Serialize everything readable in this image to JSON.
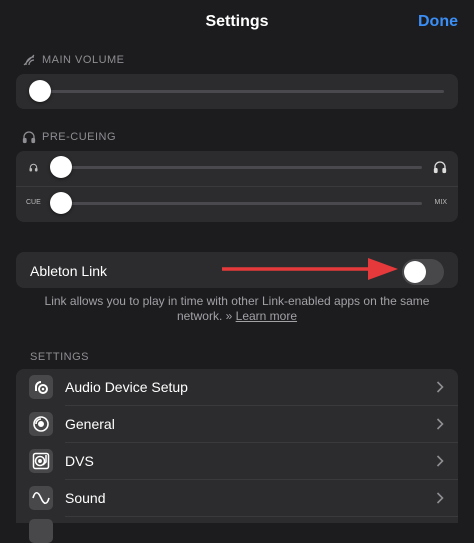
{
  "header": {
    "title": "Settings",
    "done_label": "Done"
  },
  "main_volume": {
    "label": "MAIN VOLUME",
    "value": 0
  },
  "precueing": {
    "label": "PRE-CUEING",
    "headphone_volume": 0,
    "cue_mix_value": 0,
    "cue_label": "CUE",
    "mix_label": "MIX"
  },
  "ableton_link": {
    "label": "Ableton Link",
    "enabled": false,
    "description": "Link allows you to play in time with other Link-enabled apps on the same network. »",
    "learn_more": "Learn more"
  },
  "settings_section": {
    "label": "SETTINGS",
    "items": [
      {
        "label": "Audio Device Setup",
        "icon": "speaker-icon"
      },
      {
        "label": "General",
        "icon": "record-icon"
      },
      {
        "label": "DVS",
        "icon": "turntable-icon"
      },
      {
        "label": "Sound",
        "icon": "wave-icon"
      }
    ]
  },
  "colors": {
    "accent": "#3a8ef6",
    "background": "#1c1c1e",
    "card": "#2c2c2e",
    "arrow": "#e5393b"
  }
}
